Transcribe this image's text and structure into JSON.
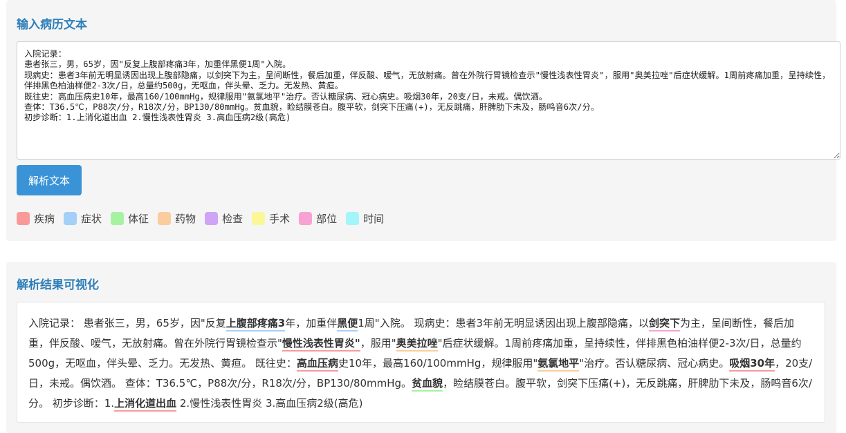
{
  "input_panel": {
    "title": "输入病历文本",
    "textarea_value": "入院记录：\n患者张三，男，65岁，因\"反复上腹部疼痛3年，加重伴黑便1周\"入院。\n现病史：患者3年前无明显诱因出现上腹部隐痛，以剑突下为主，呈间断性，餐后加重，伴反酸、嗳气，无放射痛。曾在外院行胃镜检查示\"慢性浅表性胃炎\"，服用\"奥美拉唑\"后症状缓解。1周前疼痛加重，呈持续性，伴排黑色柏油样便2-3次/日，总量约500g，无呕血，伴头晕、乏力。无发热、黄疸。\n既往史：高血压病史10年，最高160/100mmHg，规律服用\"氨氯地平\"治疗。否认糖尿病、冠心病史。吸烟30年，20支/日，未戒。偶饮酒。\n查体：T36.5℃，P88次/分，R18次/分，BP130/80mmHg。贫血貌，睑结膜苍白。腹平软，剑突下压痛(+)，无反跳痛，肝脾肋下未及，肠鸣音6次/分。\n初步诊断：1.上消化道出血 2.慢性浅表性胃炎 3.高血压病2级(高危)",
    "parse_button_label": "解析文本"
  },
  "legend": [
    {
      "key": "disease",
      "label": "疾病",
      "color": "#f99a9a"
    },
    {
      "key": "symptom",
      "label": "症状",
      "color": "#a3cff9"
    },
    {
      "key": "sign",
      "label": "体征",
      "color": "#a5f3a1"
    },
    {
      "key": "drug",
      "label": "药物",
      "color": "#fbcc9c"
    },
    {
      "key": "exam",
      "label": "检查",
      "color": "#cfa3f6"
    },
    {
      "key": "surgery",
      "label": "手术",
      "color": "#fbf797"
    },
    {
      "key": "site",
      "label": "部位",
      "color": "#f9a1d2"
    },
    {
      "key": "time",
      "label": "时间",
      "color": "#a3f5f9"
    }
  ],
  "result_panel": {
    "title": "解析结果可视化",
    "segments": [
      {
        "text": "入院记录： 患者张三，男，65岁，因\"反复"
      },
      {
        "text": "上腹部疼痛3",
        "type": "symptom"
      },
      {
        "text": "年，加重伴"
      },
      {
        "text": "黑便",
        "type": "symptom"
      },
      {
        "text": "1周\"入院。 现病史：患者3年前无明显诱因出现上腹部隐痛，以"
      },
      {
        "text": "剑突下",
        "type": "site"
      },
      {
        "text": "为主，呈间断性，餐后加重，伴反酸、嗳气，无放射痛。曾在外院行胃镜检查示\""
      },
      {
        "text": "慢性浅表性胃炎\"",
        "type": "disease"
      },
      {
        "text": "，服用\""
      },
      {
        "text": "奥美拉唑",
        "type": "drug"
      },
      {
        "text": "\"后症状缓解。1周前疼痛加重，呈持续性，伴排黑色柏油样便2-3次/日，总量约500g，无呕血，伴头晕、乏力。无发热、黄疸。 既往史："
      },
      {
        "text": "高血压病",
        "type": "disease"
      },
      {
        "text": "史10年，最高160/100mmHg，规律服用\""
      },
      {
        "text": "氨氯地平",
        "type": "drug"
      },
      {
        "text": "\"治疗。否认糖尿病、冠心病史。"
      },
      {
        "text": "吸烟30年",
        "type": "disease"
      },
      {
        "text": "，20支/日，未戒。偶饮酒。 查体：T36.5℃，P88次/分，R18次/分，BP130/80mmHg。"
      },
      {
        "text": "贫血貌",
        "type": "sign"
      },
      {
        "text": "，睑结膜苍白。腹平软，剑突下压痛(+)，无反跳痛，肝脾肋下未及，肠鸣音6次/分。 初步诊断：1."
      },
      {
        "text": "上消化道出血",
        "type": "disease"
      },
      {
        "text": " 2.慢性浅表性胃炎 3.高血压病2级(高危)"
      }
    ]
  }
}
